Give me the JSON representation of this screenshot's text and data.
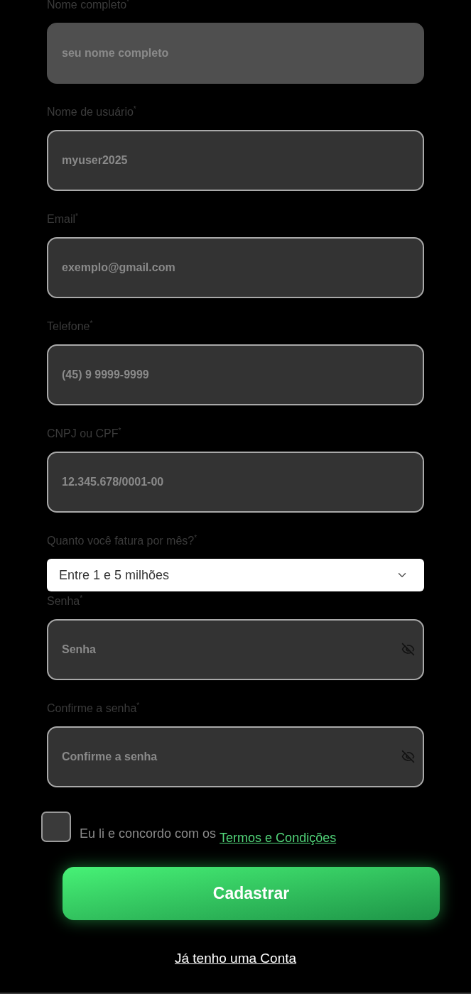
{
  "fields": [
    {
      "kind": "text",
      "label": "Nome completo$^{*}$",
      "placeholder": "seu nome completo",
      "disabled": true
    },
    {
      "kind": "text",
      "label": "Nome de usuário$^{*}$",
      "placeholder": "myuser2025",
      "disabled": false
    },
    {
      "kind": "text",
      "label": "Email$^{*}$",
      "placeholder": "exemplo@gmail.com",
      "disabled": false
    },
    {
      "kind": "text",
      "label": "Telefone$^{*}$",
      "placeholder": "(45) 9 9999-9999",
      "disabled": false
    },
    {
      "kind": "text",
      "label": "CNPJ ou CPF$^{*}$",
      "placeholder": "12.345.678/0001-00",
      "disabled": false
    },
    {
      "kind": "select",
      "label": "Quanto você fatura por mês?$^{*}$",
      "value": "Entre 1 e 5 milhões",
      "disabled": false
    },
    {
      "kind": "password",
      "label": "Senha$^{*}$",
      "placeholder": "Senha",
      "disabled": false
    },
    {
      "kind": "password",
      "label": "Confirme a senha$^{*}$",
      "placeholder": "Confirme a senha",
      "disabled": false
    }
  ],
  "terms": {
    "checked": false,
    "text": "Eu li e concordo com os",
    "link": "Termos e Condições"
  },
  "submit": {
    "label": "Cadastrar"
  },
  "login_link": "Já tenho uma Conta"
}
